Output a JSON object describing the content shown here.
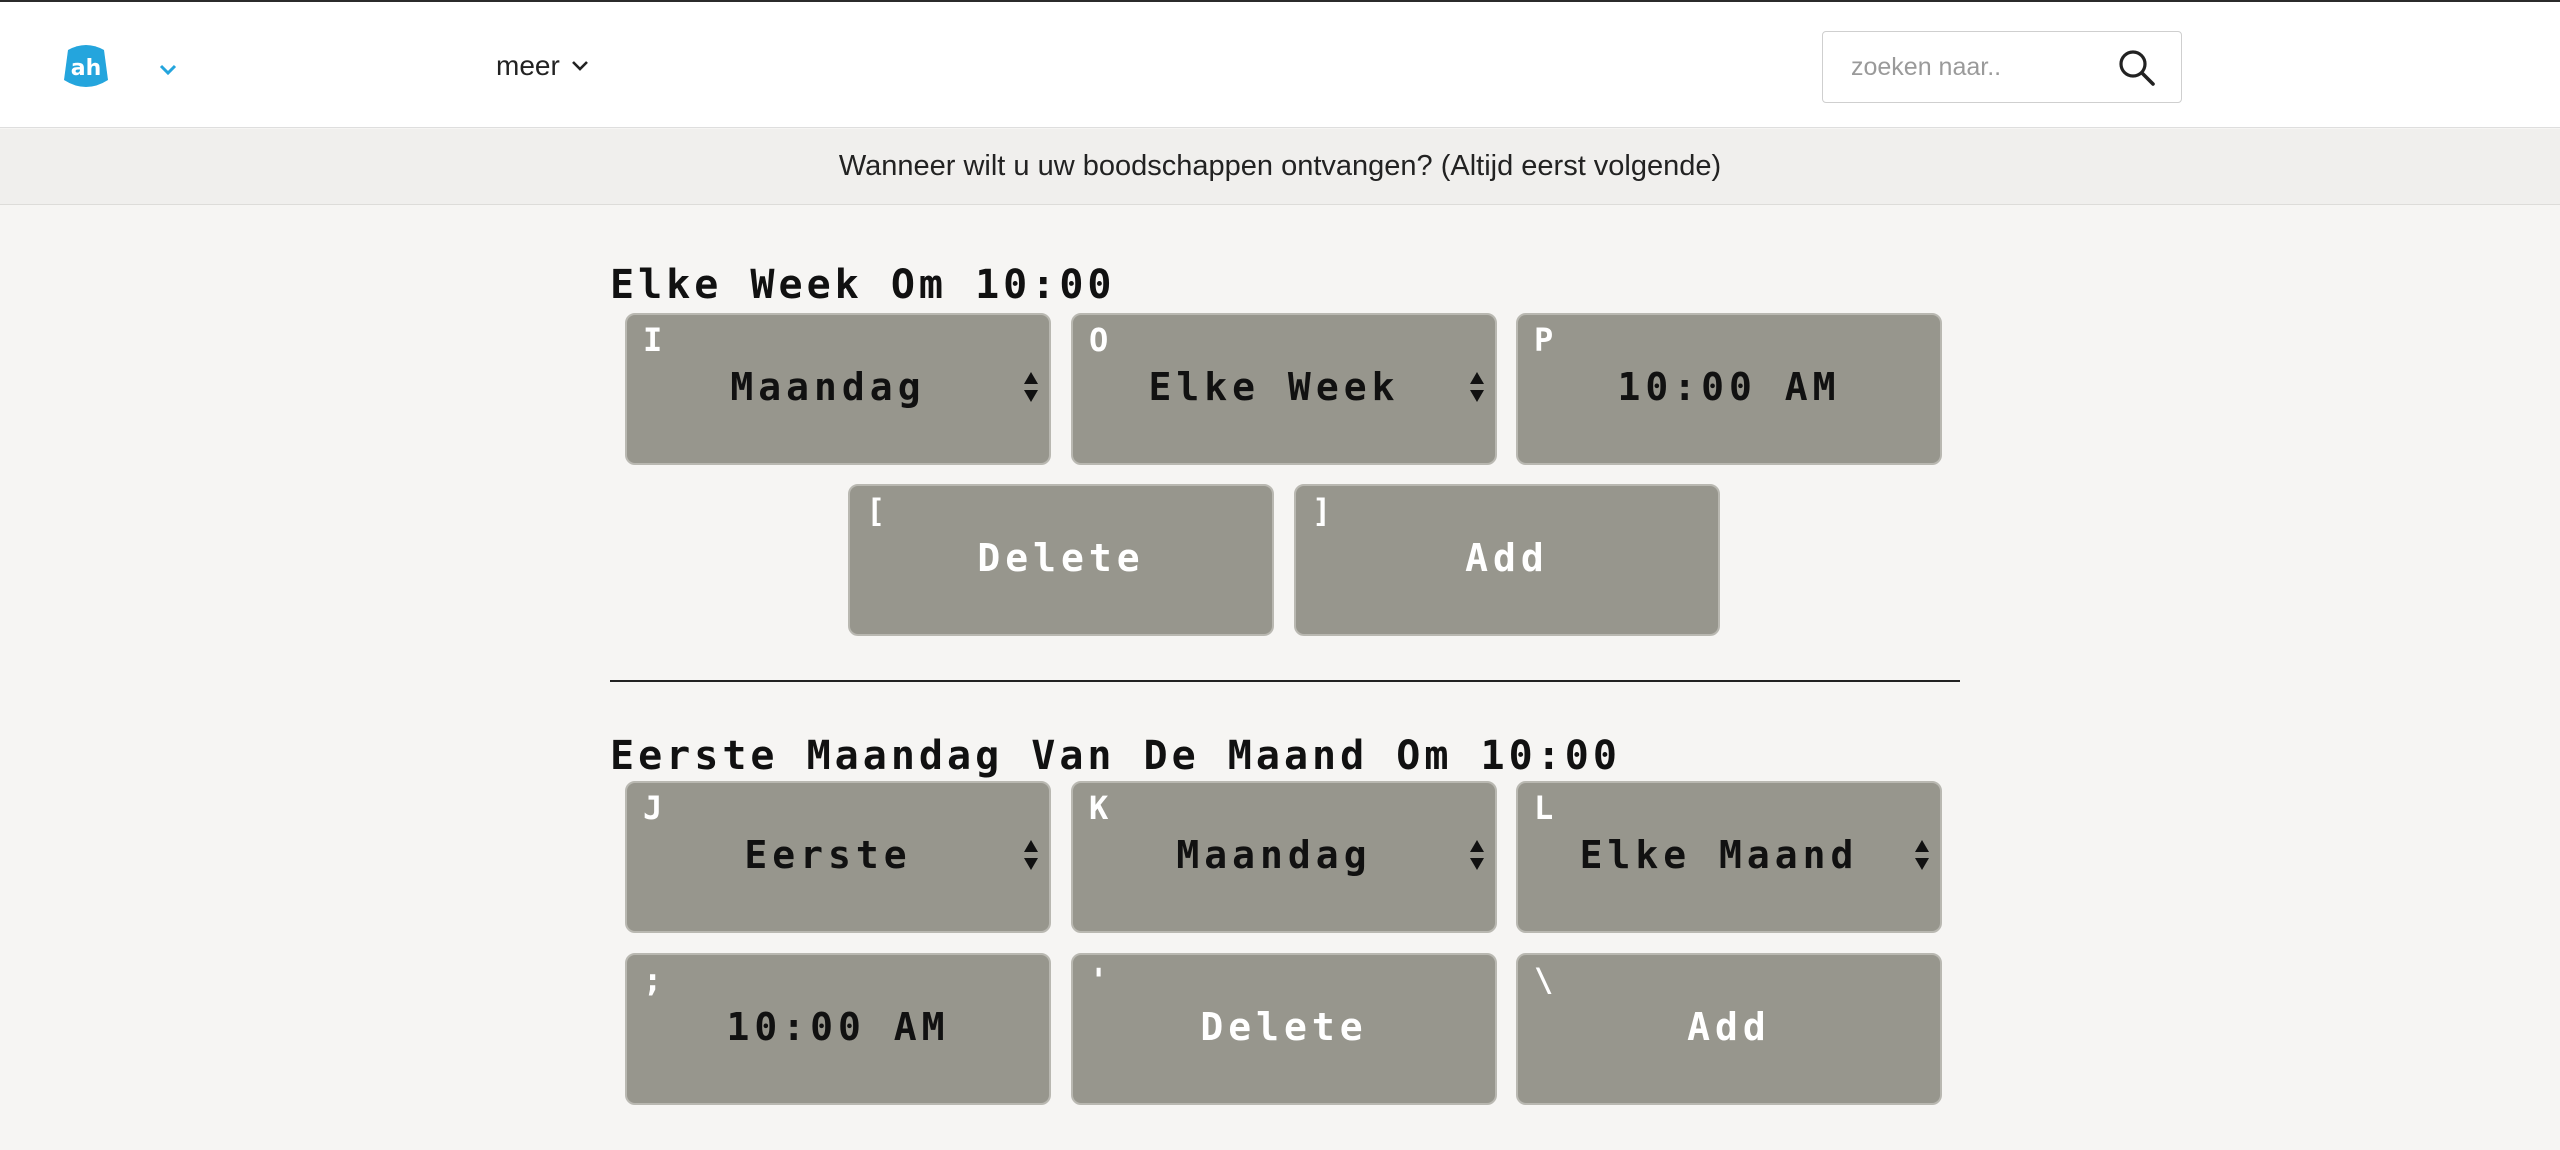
{
  "header": {
    "logo_icon": "albert-heijn-logo-icon",
    "nav_more_label": "meer",
    "search": {
      "placeholder": "zoeken naar.."
    }
  },
  "banner": {
    "text": "Wanneer wilt u uw boodschappen ontvangen? (Altijd eerst volgende)"
  },
  "colors": {
    "brand_blue": "#24a5dd",
    "tile_bg": "#97968d",
    "page_bg": "#f6f5f3"
  },
  "schedule_weekly": {
    "title": "Elke Week Om 10:00",
    "day": {
      "key": "I",
      "value": "Maandag"
    },
    "frequency": {
      "key": "O",
      "value": "Elke Week"
    },
    "time": {
      "key": "P",
      "value": "10:00 AM"
    },
    "delete": {
      "key": "[",
      "label": "Delete"
    },
    "add": {
      "key": "]",
      "label": "Add"
    }
  },
  "schedule_monthly": {
    "title": "Eerste Maandag Van De Maand Om 10:00",
    "ordinal": {
      "key": "J",
      "value": "Eerste"
    },
    "day": {
      "key": "K",
      "value": "Maandag"
    },
    "frequency": {
      "key": "L",
      "value": "Elke Maand"
    },
    "time": {
      "key": ";",
      "value": "10:00 AM"
    },
    "delete": {
      "key": "'",
      "label": "Delete"
    },
    "add": {
      "key": "\\",
      "label": "Add"
    }
  }
}
